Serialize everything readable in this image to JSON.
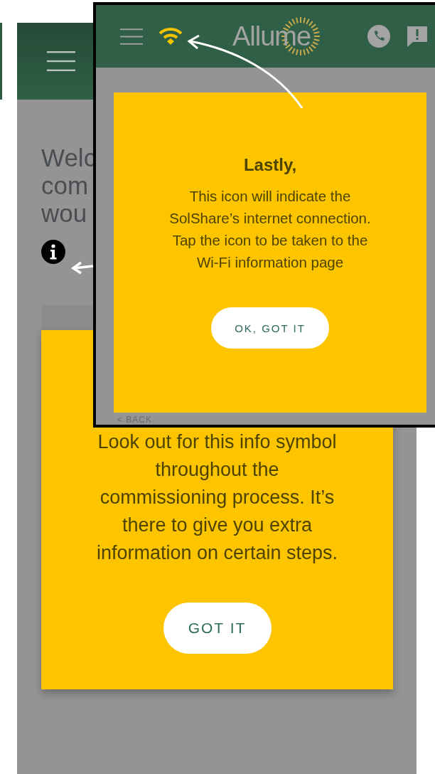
{
  "back_screen": {
    "welcome_lines": [
      "Welc",
      "com",
      "wou"
    ],
    "card": {
      "text": "Look out for this info symbol\nthroughout the\ncommissioning process. It’s\nthere to give you extra\ninformation on certain steps.",
      "button": "GOT IT"
    }
  },
  "inset_screen": {
    "logo": "Allume",
    "wifi_connected": true,
    "card": {
      "title": "Lastly,",
      "text": "This icon will indicate the\nSolShare’s internet connection.\nTap the icon to be taken to the\nWi-Fi information page",
      "button": "OK, GOT IT"
    },
    "back_link": "< BACK"
  }
}
